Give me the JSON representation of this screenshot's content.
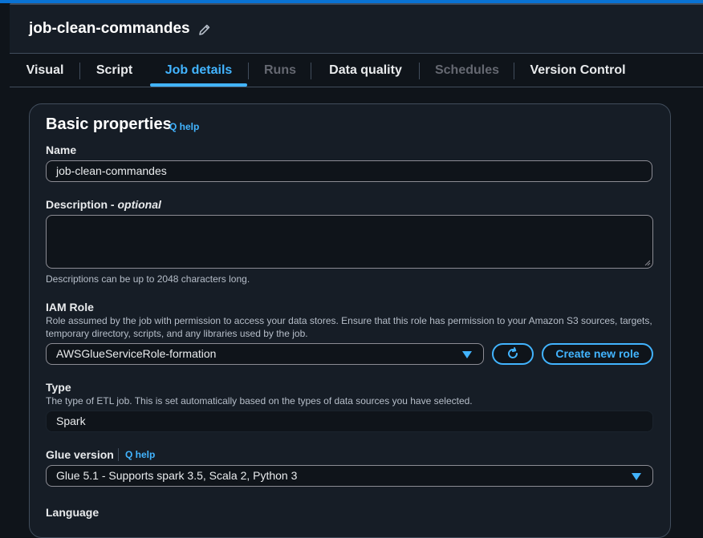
{
  "job": {
    "title": "job-clean-commandes"
  },
  "tabs": [
    {
      "label": "Visual",
      "state": "normal"
    },
    {
      "label": "Script",
      "state": "normal"
    },
    {
      "label": "Job details",
      "state": "active"
    },
    {
      "label": "Runs",
      "state": "disabled"
    },
    {
      "label": "Data quality",
      "state": "normal"
    },
    {
      "label": "Schedules",
      "state": "disabled"
    },
    {
      "label": "Version Control",
      "state": "normal"
    }
  ],
  "basic": {
    "heading": "Basic properties",
    "help": "Q help",
    "name": {
      "label": "Name",
      "value": "job-clean-commandes"
    },
    "description": {
      "label": "Description - ",
      "label_optional": "optional",
      "value": "",
      "hint": "Descriptions can be up to 2048 characters long."
    },
    "iam": {
      "label": "IAM Role",
      "desc": "Role assumed by the job with permission to access your data stores. Ensure that this role has permission to your Amazon S3 sources, targets, temporary directory, scripts, and any libraries used by the job.",
      "selected": "AWSGlueServiceRole-formation",
      "refresh_icon": "refresh-icon",
      "create_label": "Create new role"
    },
    "type": {
      "label": "Type",
      "desc": "The type of ETL job. This is set automatically based on the types of data sources you have selected.",
      "value": "Spark"
    },
    "glue": {
      "label": "Glue version",
      "help": "Q help",
      "selected": "Glue 5.1 - Supports spark 3.5, Scala 2, Python 3"
    },
    "language": {
      "label": "Language"
    }
  },
  "colors": {
    "accent": "#42b4ff",
    "background": "#0f141a",
    "panel": "#161d26",
    "border": "#414d5c"
  }
}
